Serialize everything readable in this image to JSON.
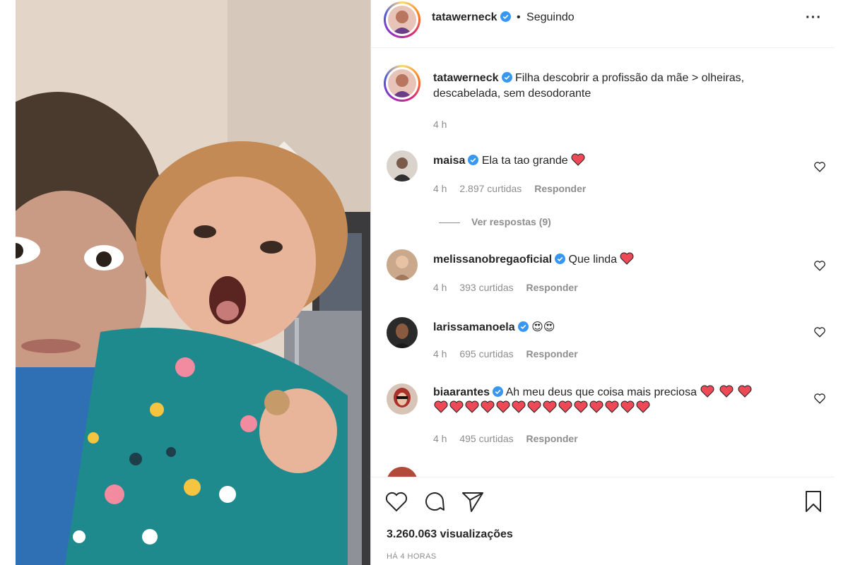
{
  "post": {
    "author": "tatawerneck",
    "follow_state": "Seguindo",
    "separator": "•",
    "more_label": "···",
    "caption": "Filha descobrir a profissão da mãe > olheiras, descabelada, sem desodorante",
    "caption_time": "4 h"
  },
  "comments": [
    {
      "user": "maisa",
      "text": "Ela ta tao grande",
      "hearts": 1,
      "time": "4 h",
      "likes": "2.897 curtidas",
      "reply": "Responder",
      "view_replies": "Ver respostas (9)"
    },
    {
      "user": "melissanobregaoficial",
      "text": "Que linda",
      "hearts": 1,
      "time": "4 h",
      "likes": "393 curtidas",
      "reply": "Responder"
    },
    {
      "user": "larissamanoela",
      "text": "😍😍",
      "hearts": 0,
      "time": "4 h",
      "likes": "695 curtidas",
      "reply": "Responder"
    },
    {
      "user": "biaarantes",
      "text": "Ah meu deus que coisa mais preciosa",
      "hearts": 3,
      "extra_hearts": 14,
      "time": "4 h",
      "likes": "495 curtidas",
      "reply": "Responder"
    }
  ],
  "footer": {
    "views": "3.260.063 visualizações",
    "time_ago": "HÁ 4 HORAS"
  },
  "icons": {
    "like": "heart-outline-icon",
    "comment": "speech-bubble-icon",
    "share": "paper-plane-icon",
    "save": "bookmark-icon",
    "verified": "verified-badge-icon"
  },
  "colors": {
    "verified": "#3897f0",
    "heart": "#ed4956",
    "muted": "#8e8e8e",
    "text": "#262626"
  }
}
